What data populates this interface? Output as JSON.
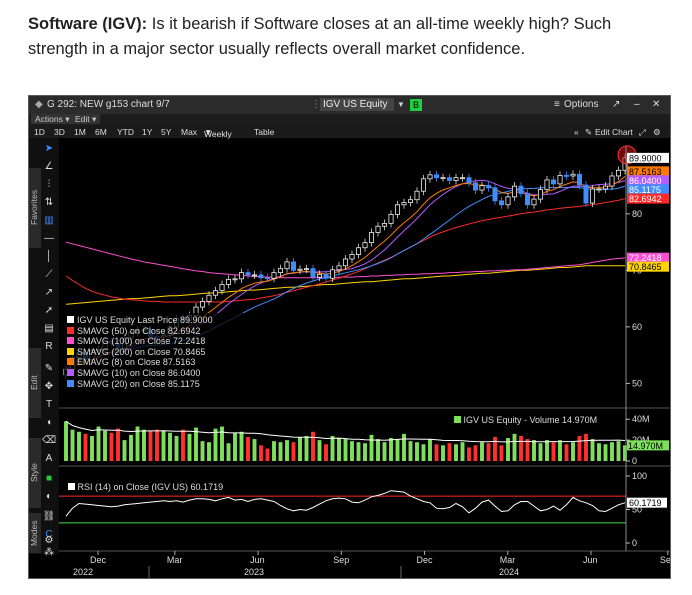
{
  "caption": {
    "bold": "Software (IGV):",
    "text": " Is it bearish if Software closes at an all-time weekly high? Such strength in a major sector usually reflects overall market confidence."
  },
  "window": {
    "title": "G 292: NEW g153 chart 9/7",
    "ticker": "IGV US Equity",
    "options_label": "Options",
    "menu_actions": "Actions",
    "menu_edit": "Edit"
  },
  "ranges": [
    "1D",
    "3D",
    "1M",
    "6M",
    "YTD",
    "1Y",
    "5Y",
    "Max"
  ],
  "period_label": "Weekly",
  "table_label": "Table",
  "edit_chart_label": "Edit Chart",
  "side_tabs": [
    "Favorites",
    "Edit",
    "Style",
    "Modes"
  ],
  "legend": [
    {
      "label": "IGV US Equity",
      "study": "Last Price",
      "value": "89.9000",
      "color": "#ffffff"
    },
    {
      "label": "SMAVG (50)",
      "study": "on Close",
      "value": "82.6942",
      "color": "#ff2a2a"
    },
    {
      "label": "SMAVG (100)",
      "study": "on Close",
      "value": "72.2418",
      "color": "#ff4fd0"
    },
    {
      "label": "SMAVG (200)",
      "study": "on Close",
      "value": "70.8465",
      "color": "#ffd400"
    },
    {
      "label": "EMAVG (8)",
      "study": "on Close",
      "value": "87.5163",
      "color": "#ff7a00"
    },
    {
      "label": "SMAVG (10)",
      "study": "on Close",
      "value": "86.0400",
      "color": "#b45cff"
    },
    {
      "label": "SMAVG (20)",
      "study": "on Close",
      "value": "85.1175",
      "color": "#3f8dff"
    }
  ],
  "volume_legend": "IGV US Equity - Volume 14.970M",
  "rsi_legend": "RSI (14) on Close (IGV US) 60.1719",
  "chart_data": {
    "type": "line",
    "price_axis": {
      "ticks": [
        50,
        60,
        70,
        80
      ],
      "labels": [
        "50",
        "60",
        "70",
        "80"
      ],
      "ylim": [
        46,
        92
      ]
    },
    "volume_axis": {
      "ticks": [
        "40M",
        "20M",
        "0"
      ],
      "last": "14.970M"
    },
    "rsi_axis": {
      "ticks": [
        "100",
        "50",
        "0"
      ],
      "last": "60.1719",
      "levels": [
        70,
        30
      ]
    },
    "price_flags": [
      {
        "value": "89.9000",
        "color": "#ffffff"
      },
      {
        "value": "87.5163",
        "color": "#ff7a00"
      },
      {
        "value": "86.0400",
        "color": "#b45cff"
      },
      {
        "value": "85.1175",
        "color": "#3f8dff"
      },
      {
        "value": "82.6942",
        "color": "#ff2a2a"
      },
      {
        "value": "72.2418",
        "color": "#ff4fd0"
      },
      {
        "value": "70.8465",
        "color": "#ffd400"
      }
    ],
    "x_month_labels": [
      "Dec",
      "Mar",
      "Jun",
      "Sep",
      "Dec",
      "Mar",
      "Jun",
      "Sep"
    ],
    "x_year_labels": [
      "2022",
      "2023",
      "2024"
    ],
    "closes": [
      52.5,
      54.6,
      55.5,
      54.2,
      55.8,
      56.0,
      57.5,
      57.0,
      56.2,
      58.0,
      59.0,
      59.4,
      59.5,
      58.3,
      58.2,
      58.5,
      60.0,
      61.5,
      61.2,
      62.0,
      63.5,
      64.5,
      65.6,
      66.4,
      67.5,
      68.4,
      68.5,
      69.6,
      69.2,
      69.2,
      68.7,
      68.6,
      69.6,
      70.3,
      71.5,
      70.0,
      70.2,
      70.3,
      68.8,
      69.3,
      68.6,
      70.1,
      70.8,
      72.0,
      72.8,
      74.0,
      74.9,
      76.7,
      77.8,
      78.3,
      79.9,
      81.6,
      82.0,
      82.5,
      84.0,
      86.2,
      86.9,
      86.4,
      86.4,
      85.9,
      86.4,
      86.4,
      85.5,
      84.2,
      85.0,
      84.6,
      82.3,
      81.6,
      83.0,
      84.9,
      83.6,
      81.6,
      82.6,
      84.3,
      86.0,
      85.3,
      86.8,
      86.7,
      87.0,
      85.1,
      81.9,
      84.4,
      84.4,
      84.9,
      86.7,
      87.7,
      89.9
    ],
    "sma50": [
      69.0,
      68.2,
      67.5,
      66.8,
      66.3,
      65.9,
      65.6,
      65.3,
      65.1,
      64.9,
      64.8,
      64.7,
      64.6,
      64.5,
      64.5,
      64.4,
      64.4,
      64.4,
      64.4,
      64.4,
      64.4,
      64.4,
      64.4,
      64.4,
      64.4,
      64.5,
      64.6,
      64.7,
      64.8,
      64.9,
      65.1,
      65.3,
      65.5,
      65.8,
      66.1,
      66.4,
      66.7,
      67.0,
      67.3,
      67.6,
      67.9,
      68.3,
      68.6,
      69.0,
      69.4,
      69.8,
      70.3,
      70.8,
      71.3,
      71.8,
      72.3,
      72.9,
      73.5,
      74.1,
      74.7,
      75.3,
      75.9,
      76.4,
      76.8,
      77.2,
      77.6,
      77.9,
      78.2,
      78.5,
      78.8,
      79.0,
      79.2,
      79.4,
      79.6,
      79.8,
      80.0,
      80.2,
      80.3,
      80.5,
      80.7,
      80.8,
      81.0,
      81.1,
      81.2,
      81.3,
      81.5,
      81.6,
      81.8,
      82.0,
      82.2,
      82.4,
      82.7
    ],
    "sma100": [
      75.0,
      74.7,
      74.4,
      74.1,
      73.8,
      73.5,
      73.2,
      72.9,
      72.6,
      72.3,
      72.0,
      71.8,
      71.5,
      71.3,
      71.1,
      70.9,
      70.7,
      70.5,
      70.3,
      70.1,
      69.9,
      69.8,
      69.6,
      69.5,
      69.4,
      69.3,
      69.2,
      69.1,
      69.0,
      68.9,
      68.9,
      68.8,
      68.8,
      68.7,
      68.7,
      68.7,
      68.7,
      68.7,
      68.7,
      68.7,
      68.7,
      68.7,
      68.8,
      68.8,
      68.8,
      68.9,
      68.9,
      69.0,
      69.0,
      69.1,
      69.1,
      69.2,
      69.2,
      69.3,
      69.3,
      69.4,
      69.4,
      69.5,
      69.5,
      69.6,
      69.6,
      69.7,
      69.7,
      69.8,
      69.8,
      69.9,
      69.9,
      70.0,
      70.0,
      70.1,
      70.1,
      70.2,
      70.3,
      70.4,
      70.5,
      70.6,
      70.7,
      70.8,
      70.9,
      71.0,
      71.2,
      71.4,
      71.6,
      71.8,
      72.0,
      72.1,
      72.2
    ],
    "sma200": [
      64.0,
      64.1,
      64.2,
      64.3,
      64.4,
      64.5,
      64.6,
      64.7,
      64.8,
      64.9,
      65.0,
      65.0,
      65.1,
      65.2,
      65.3,
      65.4,
      65.5,
      65.5,
      65.6,
      65.7,
      65.8,
      65.9,
      66.0,
      66.0,
      66.1,
      66.2,
      66.3,
      66.4,
      66.5,
      66.5,
      66.6,
      66.7,
      66.8,
      66.9,
      67.0,
      67.0,
      67.1,
      67.2,
      67.3,
      67.4,
      67.5,
      67.5,
      67.6,
      67.7,
      67.8,
      67.9,
      68.0,
      68.0,
      68.1,
      68.2,
      68.3,
      68.4,
      68.5,
      68.5,
      68.6,
      68.7,
      68.8,
      68.9,
      69.0,
      69.0,
      69.1,
      69.2,
      69.3,
      69.4,
      69.5,
      69.5,
      69.6,
      69.7,
      69.8,
      69.9,
      70.0,
      70.0,
      70.1,
      70.2,
      70.3,
      70.4,
      70.5,
      70.5,
      70.6,
      70.7,
      70.8,
      70.8,
      70.8,
      70.8,
      70.8,
      70.8,
      70.8
    ],
    "volume": [
      38,
      30,
      28,
      26,
      24,
      33,
      29,
      27,
      31,
      20,
      25,
      33,
      30,
      29,
      30,
      29,
      27,
      24,
      30,
      26,
      32,
      19,
      18,
      31,
      33,
      17,
      27,
      28,
      23,
      21,
      15,
      12,
      19,
      18,
      20,
      18,
      23,
      24,
      28,
      20,
      16,
      24,
      22,
      21,
      19,
      18,
      17,
      25,
      21,
      18,
      22,
      21,
      26,
      19,
      18,
      16,
      21,
      16,
      15,
      17,
      16,
      18,
      13,
      15,
      18,
      17,
      23,
      15,
      22,
      26,
      24,
      21,
      20,
      17,
      20,
      18,
      20,
      16,
      18,
      24,
      26,
      21,
      17,
      16,
      18,
      19,
      15
    ],
    "rsi": [
      40,
      52,
      59,
      58,
      57,
      56,
      55,
      54,
      55,
      57,
      58,
      59,
      60,
      61,
      62,
      63,
      62,
      63,
      61,
      64,
      66,
      66,
      65,
      63,
      66,
      68,
      64,
      65,
      62,
      65,
      66,
      64,
      62,
      56,
      51,
      48,
      50,
      49,
      53,
      58,
      63,
      66,
      67,
      66,
      61,
      60,
      64,
      69,
      71,
      74,
      78,
      77,
      76,
      70,
      66,
      62,
      60,
      52,
      51,
      53,
      59,
      54,
      45,
      52,
      61,
      64,
      55,
      47,
      48,
      57,
      62,
      62,
      55,
      48,
      50,
      55,
      49,
      57,
      68,
      63,
      60,
      56,
      48,
      47,
      52,
      57,
      60
    ]
  }
}
